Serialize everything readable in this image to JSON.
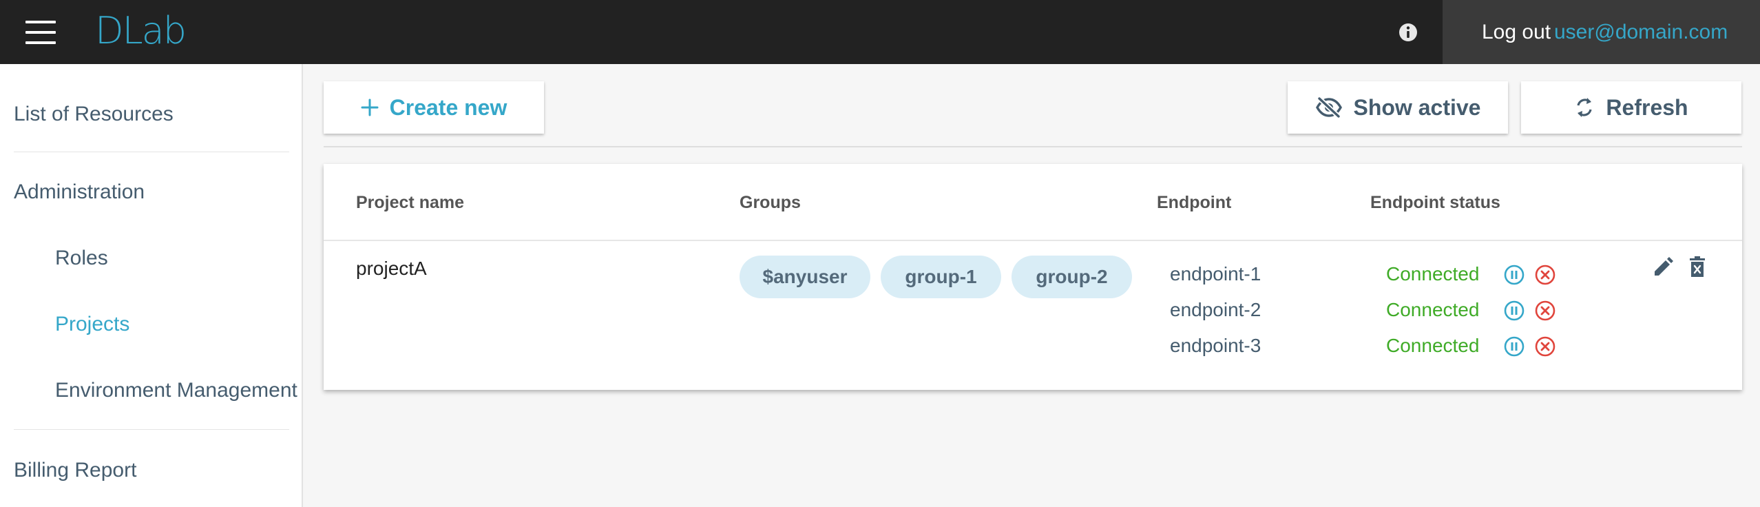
{
  "header": {
    "logo": "DLab",
    "logout_label": "Log out",
    "user_email": "user@domain.com"
  },
  "sidebar": {
    "items": [
      {
        "label": "List of Resources"
      },
      {
        "label": "Administration"
      },
      {
        "label": "Roles"
      },
      {
        "label": "Projects"
      },
      {
        "label": "Environment Management"
      },
      {
        "label": "Billing Report"
      }
    ],
    "active_item": "Projects"
  },
  "toolbar": {
    "create_label": "Create new",
    "show_active_label": "Show active",
    "refresh_label": "Refresh"
  },
  "table": {
    "columns": [
      "Project name",
      "Groups",
      "Endpoint",
      "Endpoint status"
    ],
    "rows": [
      {
        "project_name": "projectA",
        "groups": [
          "$anyuser",
          "group-1",
          "group-2"
        ],
        "endpoints": [
          {
            "name": "endpoint-1",
            "status": "Connected"
          },
          {
            "name": "endpoint-2",
            "status": "Connected"
          },
          {
            "name": "endpoint-3",
            "status": "Connected"
          }
        ]
      }
    ]
  },
  "colors": {
    "accent": "#35a7c9",
    "topbar": "#222222",
    "status_connected": "#3fab27",
    "stop": "#e0453c",
    "chip_bg": "#d9edf6"
  },
  "icons": [
    "menu-icon",
    "info-icon",
    "plus-icon",
    "eye-off-icon",
    "refresh-icon",
    "pause-icon",
    "close-circle-icon",
    "edit-icon",
    "delete-icon"
  ]
}
